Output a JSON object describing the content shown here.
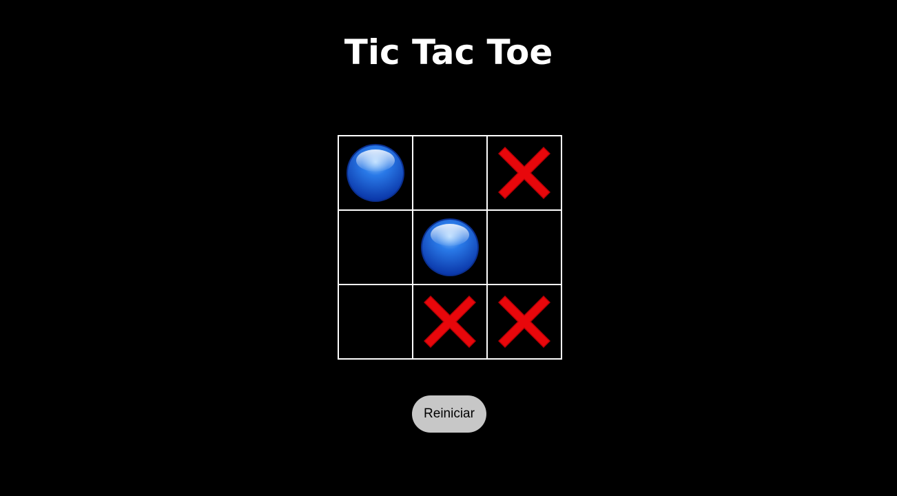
{
  "title": "Tic Tac Toe",
  "board": {
    "cells": [
      "O",
      "",
      "X",
      "",
      "O",
      "",
      "",
      "X",
      "X"
    ],
    "o_icon": "blue-circle-icon",
    "x_icon": "red-cross-icon",
    "o_color": "#1a5fd6",
    "x_color": "#e8070b",
    "grid_color": "#ffffff"
  },
  "restart_label": "Reiniciar",
  "colors": {
    "background": "#000000",
    "button_bg": "#c7c7c7"
  }
}
